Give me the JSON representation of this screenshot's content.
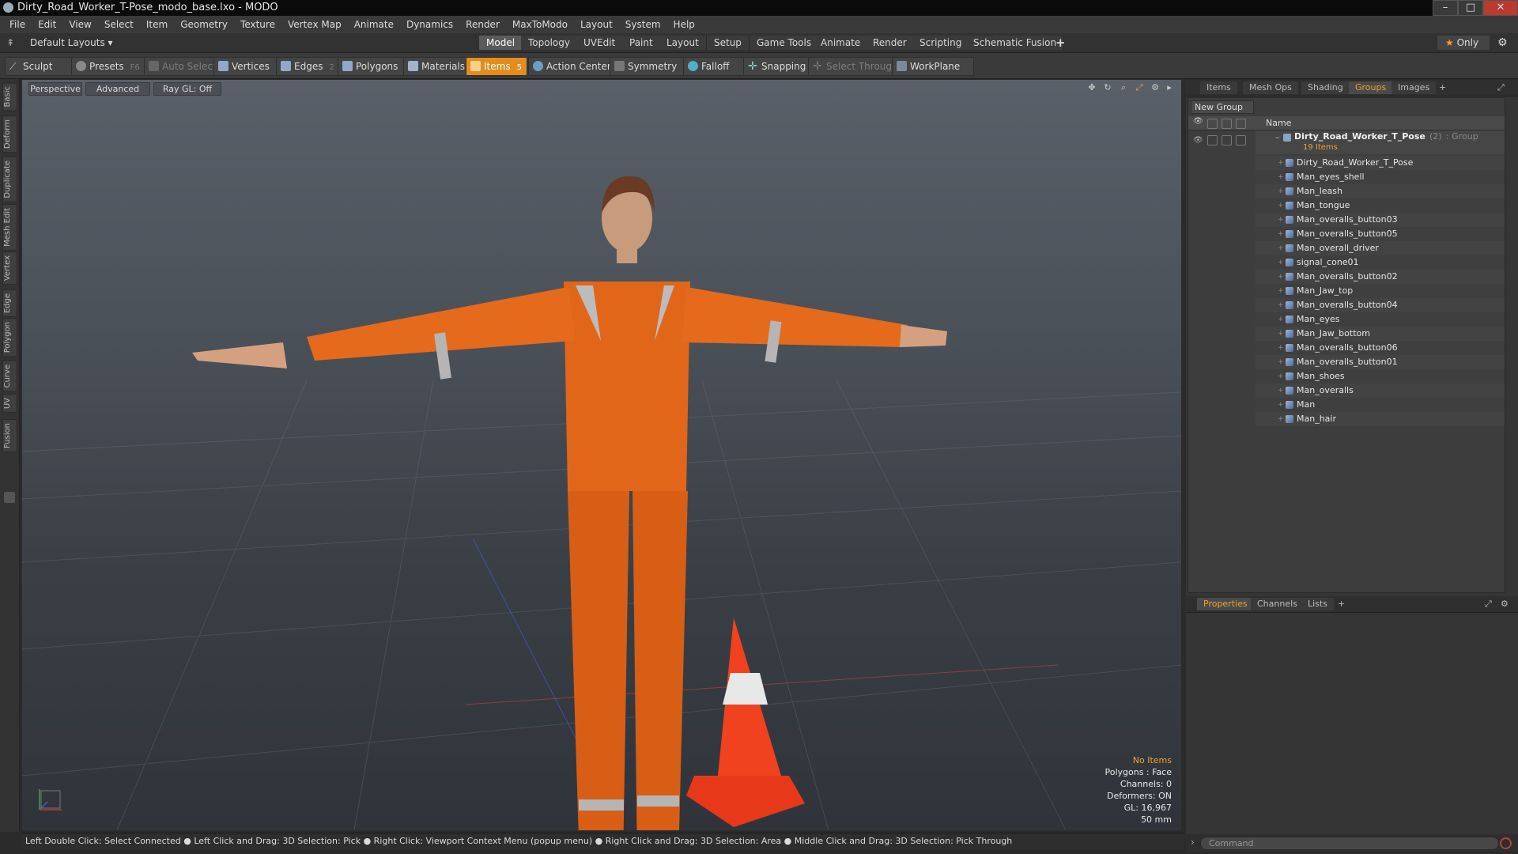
{
  "window": {
    "title": "Dirty_Road_Worker_T-Pose_modo_base.lxo - MODO",
    "controls": [
      "minimize-icon",
      "maximize-icon",
      "close-icon"
    ]
  },
  "menu": [
    "File",
    "Edit",
    "View",
    "Select",
    "Item",
    "Geometry",
    "Texture",
    "Vertex Map",
    "Animate",
    "Dynamics",
    "Render",
    "MaxToModo",
    "Layout",
    "System",
    "Help"
  ],
  "layout_bar": {
    "layouts_label": "Default Layouts",
    "tabs": [
      "Model",
      "Topology",
      "UVEdit",
      "Paint",
      "Layout",
      "Setup",
      "Game Tools",
      "Animate",
      "Render",
      "Scripting",
      "Schematic Fusion"
    ],
    "active_tab": "Model",
    "add_tab": "+",
    "only_label": "Only"
  },
  "toolbar": {
    "sculpt": "Sculpt",
    "presets": "Presets",
    "presets_key": "F6",
    "auto_select": "Auto Select",
    "vertices": "Vertices",
    "vertices_count": "1",
    "edges": "Edges",
    "edges_count": "2",
    "polygons": "Polygons",
    "materials": "Materials",
    "items": "Items",
    "items_count": "5",
    "action_center": "Action Center",
    "symmetry": "Symmetry",
    "falloff": "Falloff",
    "snapping": "Snapping",
    "select_through": "Select Through",
    "workplane": "WorkPlane"
  },
  "left_tabs": [
    "Basic",
    "Deform",
    "Duplicate",
    "Mesh Edit",
    "Vertex",
    "Edge",
    "Polygon",
    "Curve",
    "UV",
    "Fusion"
  ],
  "viewport": {
    "perspective": "Perspective",
    "advanced": "Advanced",
    "raygl": "Ray GL: Off",
    "stats": {
      "selection": "No Items",
      "polygons": "Polygons : Face",
      "channels": "Channels: 0",
      "deformers": "Deformers: ON",
      "gl": "GL: 16,967",
      "focal": "50 mm"
    }
  },
  "status_bar": "Left Double Click: Select Connected ● Left Click and Drag: 3D Selection: Pick ● Right Click: Viewport Context Menu (popup menu) ● Right Click and Drag: 3D Selection: Area ● Middle Click and Drag: 3D Selection: Pick Through",
  "right_panel": {
    "tabs": [
      "Items",
      "Mesh Ops",
      "Shading",
      "Groups",
      "Images"
    ],
    "active_tab": "Groups",
    "new_group": "New Group",
    "column_name": "Name",
    "group": {
      "name": "Dirty_Road_Worker_T_Pose",
      "count": "(2)",
      "type": ": Group",
      "items_label": "19 Items"
    },
    "items": [
      "Dirty_Road_Worker_T_Pose",
      "Man_eyes_shell",
      "Man_leash",
      "Man_tongue",
      "Man_overalls_button03",
      "Man_overalls_button05",
      "Man_overall_driver",
      "signal_cone01",
      "Man_overalls_button02",
      "Man_Jaw_top",
      "Man_overalls_button04",
      "Man_eyes",
      "Man_Jaw_bottom",
      "Man_overalls_button06",
      "Man_overalls_button01",
      "Man_shoes",
      "Man_overalls",
      "Man",
      "Man_hair"
    ],
    "bottom_tabs": [
      "Properties",
      "Channels",
      "Lists"
    ],
    "bottom_active": "Properties",
    "command_placeholder": "Command"
  }
}
